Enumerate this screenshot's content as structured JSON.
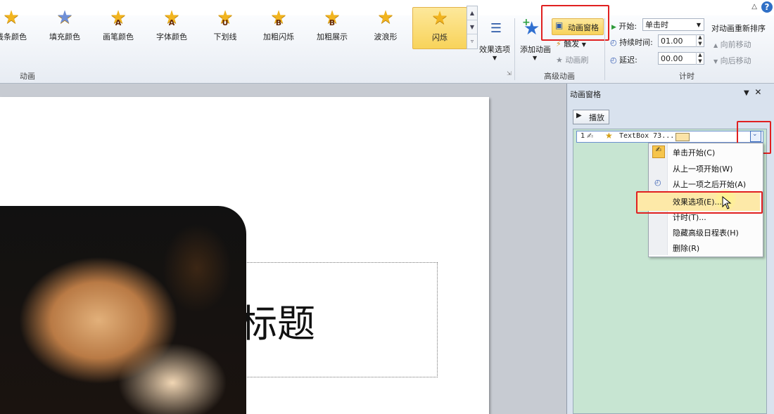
{
  "ribbon": {
    "gallery": [
      {
        "label": "线条颜色",
        "glyph": ""
      },
      {
        "label": "填充颜色",
        "glyph": ""
      },
      {
        "label": "画笔颜色",
        "glyph": "A"
      },
      {
        "label": "字体颜色",
        "glyph": "A"
      },
      {
        "label": "下划线",
        "glyph": "U"
      },
      {
        "label": "加粗闪烁",
        "glyph": "B"
      },
      {
        "label": "加粗展示",
        "glyph": "B"
      },
      {
        "label": "波浪形",
        "glyph": ""
      },
      {
        "label": "闪烁",
        "glyph": ""
      }
    ],
    "effect_options": "效果选项",
    "group_animation": "动画",
    "add_animation": "添加动画",
    "animation_pane": "动画窗格",
    "trigger": "触发",
    "animation_painter": "动画刷",
    "group_advanced": "高级动画",
    "start_label": "开始:",
    "start_value": "单击时",
    "duration_label": "持续时间:",
    "duration_value": "01.00",
    "delay_label": "延迟:",
    "delay_value": "00.00",
    "group_timing": "计时",
    "reorder_title": "对动画重新排序",
    "move_earlier": "向前移动",
    "move_later": "向后移动"
  },
  "slide": {
    "title_partial": "标题"
  },
  "pane": {
    "title": "动画窗格",
    "play": "播放",
    "item_number": "1",
    "item_name": "TextBox 73..."
  },
  "menu": {
    "items": [
      "单击开始(C)",
      "从上一项开始(W)",
      "从上一项之后开始(A)",
      "效果选项(E)...",
      "计时(T)...",
      "隐藏高级日程表(H)",
      "删除(R)"
    ]
  },
  "colors": {
    "highlight_red": "#e02020",
    "selected_gold": "#f8d35a",
    "pane_list_green": "#c7e5d2"
  }
}
